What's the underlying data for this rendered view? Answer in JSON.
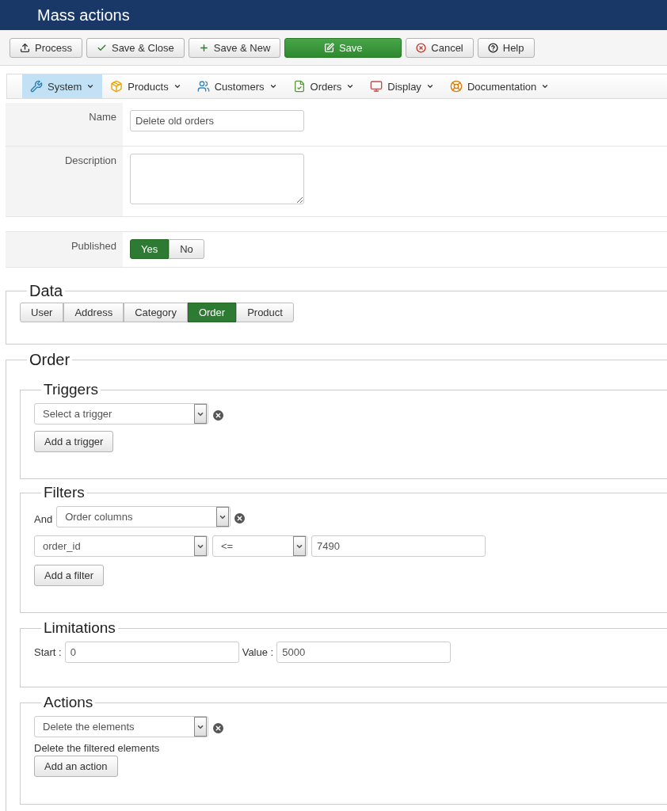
{
  "header": {
    "title": "Mass actions"
  },
  "toolbar": [
    {
      "label": "Process",
      "kind": "upload",
      "primary": false
    },
    {
      "label": "Save & Close",
      "kind": "check",
      "primary": false
    },
    {
      "label": "Save & New",
      "kind": "plus",
      "primary": false
    },
    {
      "label": "Save",
      "kind": "edit",
      "primary": true
    },
    {
      "label": "Cancel",
      "kind": "cancel",
      "primary": false
    },
    {
      "label": "Help",
      "kind": "help",
      "primary": false
    }
  ],
  "menu": [
    {
      "label": "System",
      "kind": "tools",
      "selected": true
    },
    {
      "label": "Products",
      "kind": "box",
      "selected": false
    },
    {
      "label": "Customers",
      "kind": "users",
      "selected": false
    },
    {
      "label": "Orders",
      "kind": "orders",
      "selected": false
    },
    {
      "label": "Display",
      "kind": "display",
      "selected": false
    },
    {
      "label": "Documentation",
      "kind": "help",
      "selected": false
    }
  ],
  "form": {
    "name_label": "Name",
    "name_value": "Delete old orders",
    "description_label": "Description",
    "published_label": "Published",
    "published_options": [
      {
        "label": "Yes",
        "selected": true
      },
      {
        "label": "No",
        "selected": false
      }
    ]
  },
  "data": {
    "title": "Data",
    "tabs": [
      {
        "label": "User",
        "selected": false
      },
      {
        "label": "Address",
        "selected": false
      },
      {
        "label": "Category",
        "selected": false
      },
      {
        "label": "Order",
        "selected": true
      },
      {
        "label": "Product",
        "selected": false
      }
    ]
  },
  "order": {
    "title": "Order",
    "triggers": {
      "title": "Triggers",
      "select": "Select a trigger",
      "button": "Add a trigger"
    },
    "filters": {
      "title": "Filters",
      "and_label": "And",
      "group_select": "Order columns",
      "column_select": "order_id",
      "operator_select": "<=",
      "value": "7490",
      "button": "Add a filter"
    },
    "limitations": {
      "title": "Limitations",
      "start_label": "Start :",
      "start_value": "0",
      "value_label": "Value :",
      "value_value": "5000"
    },
    "actions": {
      "title": "Actions",
      "select": "Delete the elements",
      "description": "Delete the filtered elements",
      "button": "Add an action"
    }
  }
}
